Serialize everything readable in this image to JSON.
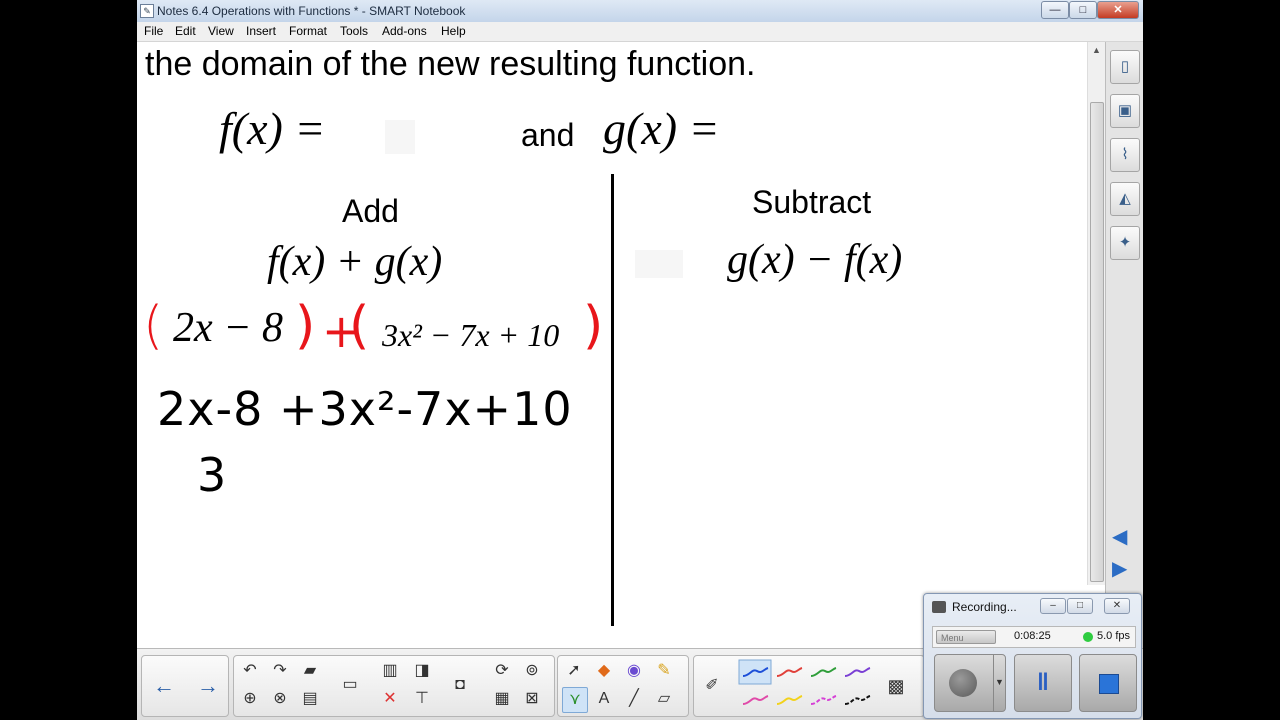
{
  "window": {
    "title": "Notes 6.4 Operations with Functions * - SMART Notebook",
    "controls": {
      "minimize": "—",
      "maximize": "□",
      "close": "✕"
    }
  },
  "menu": [
    "File",
    "Edit",
    "View",
    "Insert",
    "Format",
    "Tools",
    "Add-ons",
    "Help"
  ],
  "page": {
    "heading_line": "the domain of the new resulting function.",
    "f_label": "f(x) =",
    "and_label": "and",
    "g_label": "g(x) =",
    "left": {
      "title": "Add",
      "formula": "f(x) + g(x)",
      "expr_open": "(",
      "expr_a": "2x − 8",
      "expr_close": ")",
      "expr_plus": "+",
      "expr_b": "3x² − 7x + 10",
      "work_line1": "2x-8 +3x²-7x+10",
      "work_line2": "3"
    },
    "right": {
      "title": "Subtract",
      "formula": "g(x) − f(x)"
    }
  },
  "sidebar": {
    "tabs": [
      "page-sorter-icon",
      "gallery-icon",
      "attachments-icon",
      "properties-icon",
      "add-ons-icon"
    ],
    "arrows": [
      "◀",
      "▶"
    ]
  },
  "toolbar": {
    "nav": [
      "←",
      "→"
    ],
    "pen_colors": [
      "#1d4fd8",
      "#e0403a",
      "#2f9e3a",
      "#7a3fd4",
      "#e04aa8",
      "#f2d21b",
      "#d63fd6",
      "#111111"
    ]
  },
  "recorder": {
    "title": "Recording...",
    "menu_label": "Menu",
    "elapsed": "0:08:25",
    "fps": "5.0 fps",
    "status_color": "#2ecc40"
  }
}
